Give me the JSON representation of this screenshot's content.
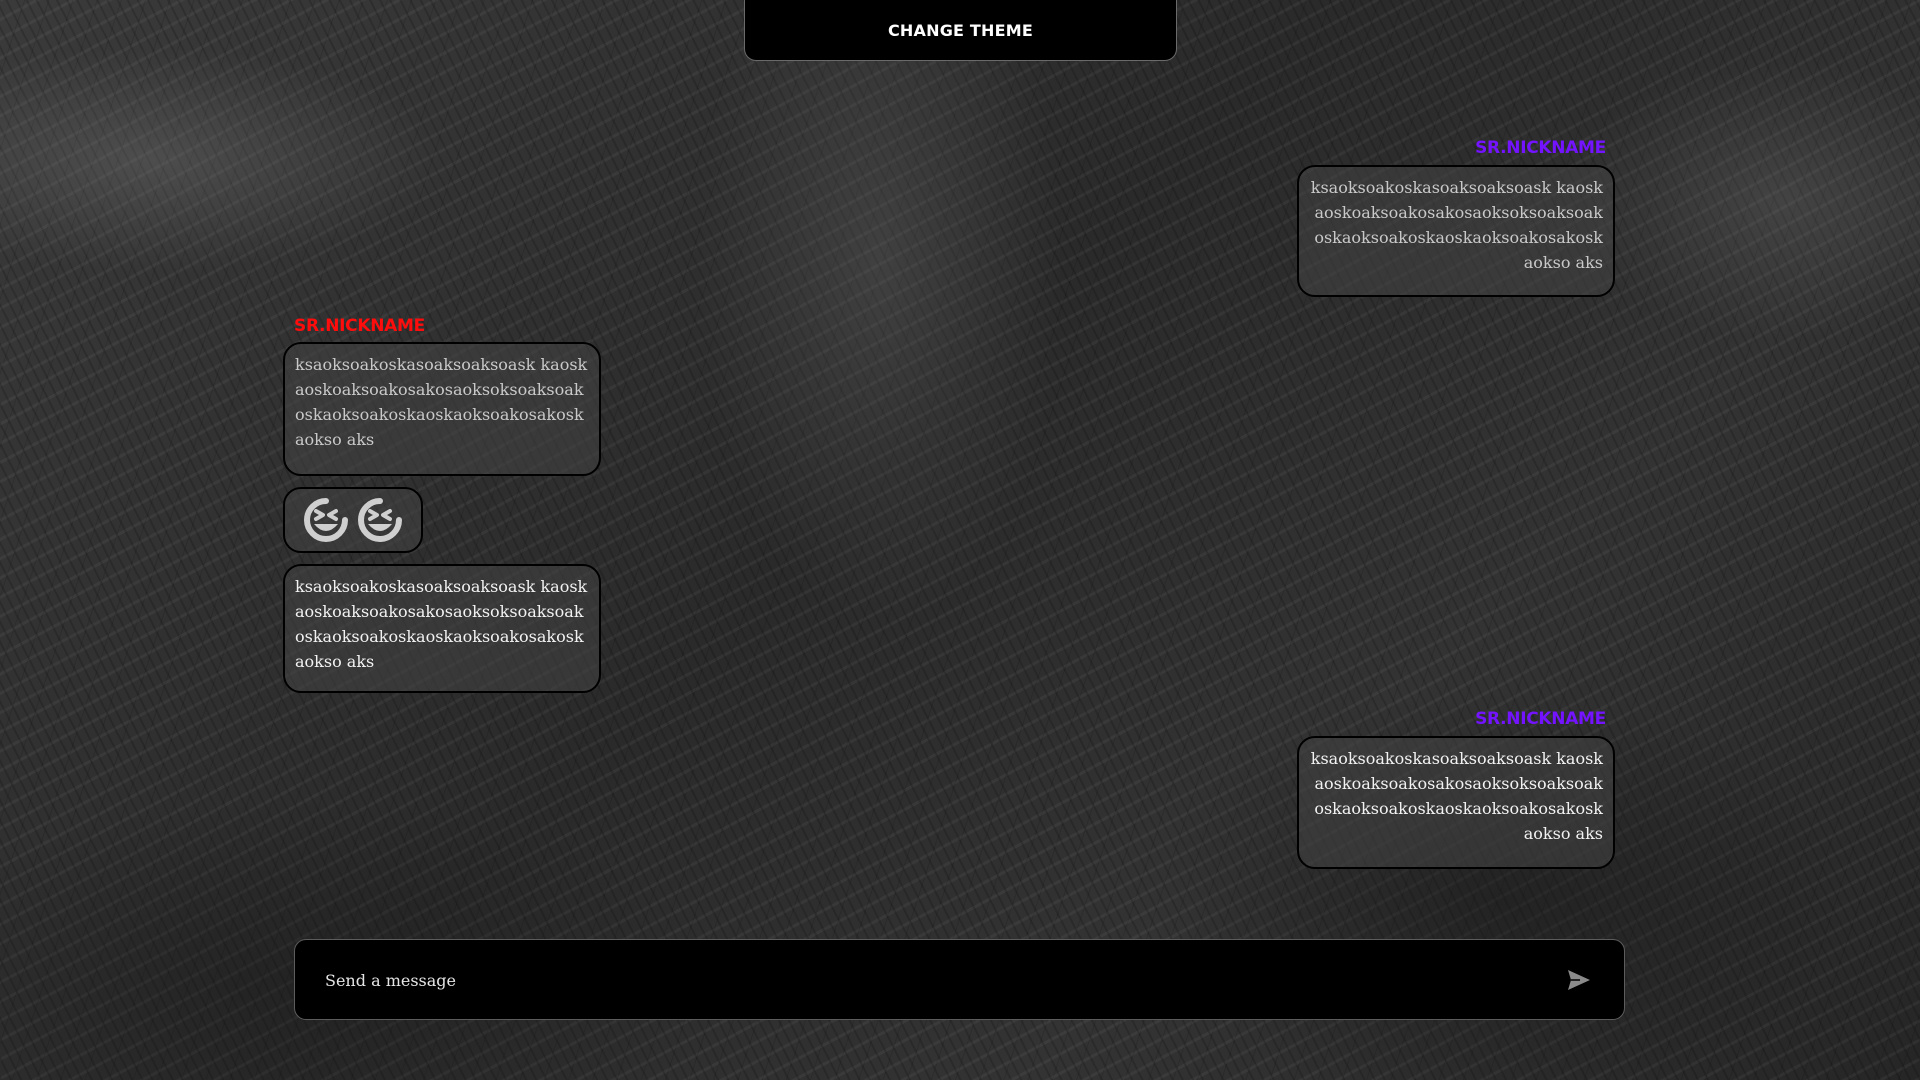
{
  "header": {
    "change_theme_label": "CHANGE THEME"
  },
  "messages": [
    {
      "side": "right",
      "nickname": "SR.NICKNAME",
      "nickname_color": "#7413ff",
      "text": "ksaoksoakoskasoaksoaksoask kaoskaoskoaksoakosakosaoksoksoaksoak oskaoksoakoskaoskaoksoakosakoskaokso aks"
    },
    {
      "side": "left",
      "nickname": "SR.NICKNAME",
      "nickname_color": "#ff0d0d",
      "text": "ksaoksoakoskasoaksoaksoask kaoskaoskoaksoakosakosaoksoksoaksoak oskaoksoakoskaoskaoksoakosakoskaokso aks"
    },
    {
      "side": "left",
      "type": "emoji",
      "emojis": [
        "grinning-squinting-face-icon",
        "grinning-squinting-face-icon"
      ]
    },
    {
      "side": "left",
      "text": "ksaoksoakoskasoaksoaksoask kaoskaoskoaksoakosakosaoksoksoaksoak oskaoksoakoskaoskaoksoakosakoskaokso aks"
    },
    {
      "side": "right",
      "nickname": "SR.NICKNAME",
      "nickname_color": "#7413ff",
      "text": "ksaoksoakoskasoaksoaksoask kaoskaoskoaksoakosakosaoksoksoaksoak oskaoksoakoskaoskaoksoakosakoskaokso aks"
    }
  ],
  "composer": {
    "placeholder": "Send a message",
    "send_icon": "send-icon"
  },
  "colors": {
    "bubble_border": "#000000",
    "accent_purple": "#7413ff",
    "accent_red": "#ff0d0d"
  }
}
